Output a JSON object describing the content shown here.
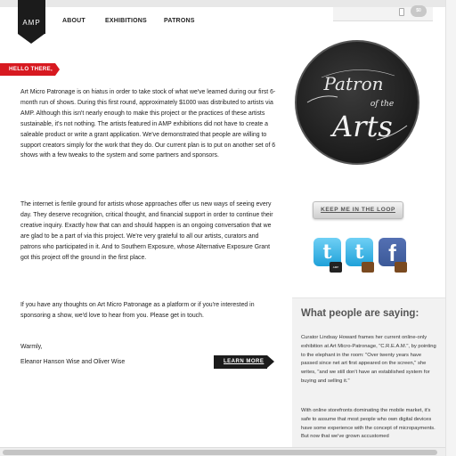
{
  "brand": {
    "logo_text": "AMP"
  },
  "nav": {
    "items": [
      "ABOUT",
      "EXHIBITIONS",
      "PATRONS"
    ]
  },
  "header_widget": {
    "badge_text": "$0"
  },
  "hello_label": "HELLO THERE,",
  "intro": {
    "paragraphs": [
      "Art Micro Patronage is on hiatus in order to take stock of what we've learned during our first 6-month run of shows. During this first round, approximately $1000 was distributed to artists via AMP. Although this isn't nearly enough to make this project or the practices of these artists sustainable, it's not nothing. The artists featured in AMP exhibitions did not have to create a saleable product or write a grant application. We've demonstrated that people are willing to support creators simply for the work that they do. Our current plan is to put on another set of 6 shows with a few tweaks to the system and some partners and sponsors.",
      "The internet is fertile ground for artists whose approaches offer us new ways of seeing every day. They deserve recognition, critical thought, and financial support in order to continue their creative inquiry. Exactly how that can and should happen is an ongoing conversation that we are glad to be a part of via this project. We're very grateful to all our artists, curators and patrons who participated in it. And to Southern Exposure, whose Alternative Exposure Grant got this project off the ground in the first place.",
      "If you have any thoughts on Art Micro Patronage as a platform or if you're interested in sponsoring a show, we'd love to hear from you. Please get in touch."
    ],
    "signoff": "Warmly,",
    "signature": "Eleanor Hanson Wise and Oliver Wise"
  },
  "learn_more_label": "LEARN MORE",
  "badge": {
    "line1": "Patron",
    "line2": "of the",
    "line3": "Arts"
  },
  "keep_me_label": "KEEP ME IN THE LOOP",
  "social": {
    "tag_amp": "AMP"
  },
  "people": {
    "title": "What people are saying:",
    "quote1": "Curator Lindsay Howard frames her current online-only exhibition at Art Micro-Patronage, \"C.R.E.A.M.\", by pointing to the elephant in the room: \"Over twenty years have passed since net art first appeared on the screen,\" she writes, \"and we still don't have an established system for buying and selling it.\"",
    "quote2": "With online storefronts dominating the mobile market, it's safe to assume that most people who own digital devices have some experience with the concept of micropayments. But now that we've grown accustomed"
  },
  "colors": {
    "accent_red": "#d71920",
    "dark": "#1b1b1b"
  }
}
